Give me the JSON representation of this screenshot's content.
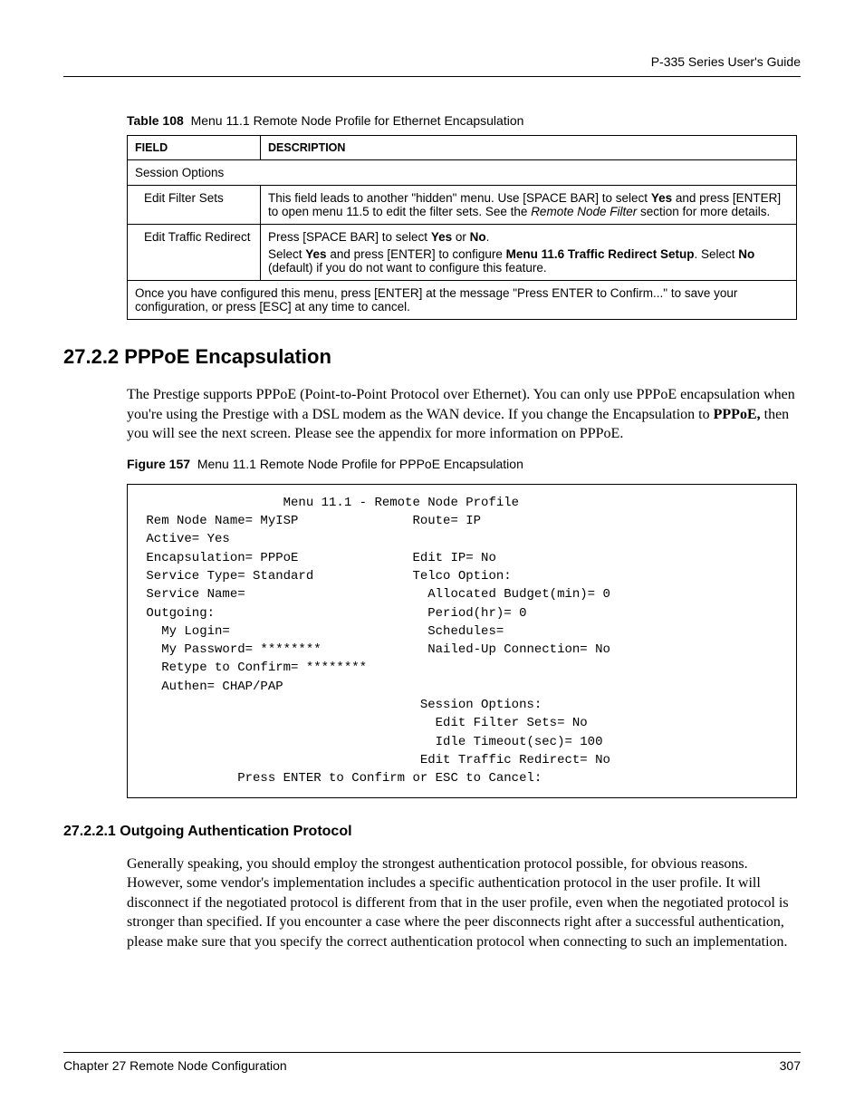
{
  "header": {
    "guide_title": "P-335 Series User's Guide"
  },
  "table_caption": {
    "prefix": "Table 108",
    "text": "Menu 11.1 Remote Node Profile for Ethernet Encapsulation"
  },
  "table": {
    "headers": {
      "field": "FIELD",
      "description": "DESCRIPTION"
    },
    "section_row": "Session Options",
    "rows": [
      {
        "field": "Edit Filter Sets",
        "desc_pre": "This field leads to another \"hidden\" menu. Use  [SPACE BAR] to select ",
        "yes": "Yes",
        "desc_mid1": " and press [ENTER] to open menu 11.5 to edit the filter sets. See the ",
        "italic": "Remote Node Filter",
        "desc_post": " section for more details."
      },
      {
        "field": "Edit Traffic Redirect",
        "line1_pre": "Press [SPACE BAR] to select ",
        "yes1": "Yes",
        "or": " or ",
        "no1": "No",
        "dot1": ".",
        "line2_pre": "Select ",
        "yes2": "Yes",
        "line2_mid": " and press [ENTER] to configure ",
        "bold_menu": "Menu 11.6 Traffic Redirect Setup",
        "line2_post": ". Select ",
        "no2": "No",
        "line2_end": " (default) if you do not want to configure this feature."
      }
    ],
    "footer_row": "Once you have configured this menu, press [ENTER] at the message \"Press ENTER to Confirm...\" to save your configuration, or press [ESC] at any time to cancel."
  },
  "section": {
    "number_title": "27.2.2  PPPoE Encapsulation",
    "para_pre": "The Prestige supports PPPoE (Point-to-Point Protocol over Ethernet). You can only use PPPoE encapsulation when you're using the Prestige with a DSL modem as the WAN device. If you change the Encapsulation to ",
    "bold": "PPPoE,",
    "para_post": " then you will see the next screen. Please see the appendix for more information on PPPoE."
  },
  "figure_caption": {
    "prefix": "Figure 157",
    "text": "Menu 11.1 Remote Node Profile for PPPoE Encapsulation"
  },
  "terminal": {
    "title": "                   Menu 11.1 - Remote Node Profile",
    "l1": " Rem Node Name= MyISP               Route= IP",
    "l2": " Active= Yes",
    "l3": " Encapsulation= PPPoE               Edit IP= No",
    "l4": " Service Type= Standard             Telco Option:",
    "l5": " Service Name=                        Allocated Budget(min)= 0",
    "l6": " Outgoing:                            Period(hr)= 0",
    "l7": "   My Login=                          Schedules=",
    "l8": "   My Password= ********              Nailed-Up Connection= No",
    "l9": "   Retype to Confirm= ********",
    "l10": "   Authen= CHAP/PAP",
    "l11": "                                     Session Options:",
    "l12": "                                       Edit Filter Sets= No",
    "l13": "                                       Idle Timeout(sec)= 100",
    "l14": "                                     Edit Traffic Redirect= No",
    "l15": "             Press ENTER to Confirm or ESC to Cancel:"
  },
  "subsection": {
    "number_title": "27.2.2.1  Outgoing Authentication Protocol",
    "para": "Generally speaking, you should employ the strongest authentication protocol possible, for obvious reasons. However, some vendor's implementation includes a specific authentication protocol in the user profile. It will disconnect if the negotiated protocol is different from that in the user profile, even when the negotiated protocol is stronger than specified. If you encounter a case where the peer disconnects right after a successful authentication, please make sure that you specify the correct authentication protocol when connecting to such an implementation."
  },
  "footer": {
    "chapter": "Chapter 27 Remote Node Configuration",
    "page": "307"
  },
  "chart_data": {
    "type": "table",
    "title": "Menu 11.1 Remote Node Profile for Ethernet Encapsulation",
    "columns": [
      "FIELD",
      "DESCRIPTION"
    ],
    "rows": [
      [
        "Session Options",
        ""
      ],
      [
        "Edit Filter Sets",
        "This field leads to another \"hidden\" menu. Use [SPACE BAR] to select Yes and press [ENTER] to open menu 11.5 to edit the filter sets. See the Remote Node Filter section for more details."
      ],
      [
        "Edit Traffic Redirect",
        "Press [SPACE BAR] to select Yes or No. Select Yes and press [ENTER] to configure Menu 11.6 Traffic Redirect Setup. Select No (default) if you do not want to configure this feature."
      ],
      [
        "",
        "Once you have configured this menu, press [ENTER] at the message \"Press ENTER to Confirm...\" to save your configuration, or press [ESC] at any time to cancel."
      ]
    ]
  }
}
